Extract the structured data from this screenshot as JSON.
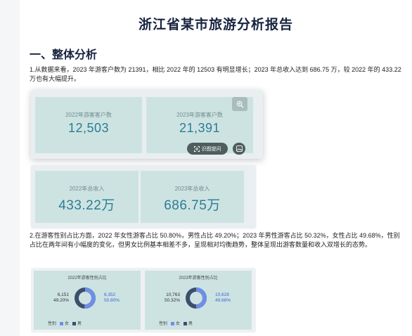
{
  "report": {
    "title": "浙江省某市旅游分析报告",
    "section1_heading": "一、整体分析",
    "paragraph1": "1.从数据来看，2023 年游客户数为 21391，相比 2022 年的 12503 有明显增长；2023 年总收入达到 686.75 万，较 2022 年的 433.22 万也有大幅提升。",
    "paragraph2": "2.在游客性别占比方面，2022 年女性游客占比 50.80%，男性占比 49.20%；2023 年男性游客占比 50.32%，女性占比 49.68%，性别占比在两年间有小幅度的变化，但男女比例基本相差不多，呈现相对均衡趋势，整体呈现出游客数量和收入双增长的态势。"
  },
  "kpis_customers": {
    "k2022_label": "2022年游客客户数",
    "k2022_value": "12,503",
    "k2023_label": "2023年游客客户数",
    "k2023_value": "21,391"
  },
  "kpis_income": {
    "k2022_label": "2022年总收入",
    "k2022_value": "433.22万",
    "k2023_label": "2023年总收入",
    "k2023_value": "686.75万"
  },
  "toolbar": {
    "ask_label": "识图提问",
    "zoom_icon": "zoom-in-icon",
    "image_icon": "image-icon"
  },
  "gender": {
    "legend_title": "性别",
    "female_label": "女",
    "male_label": "男",
    "female_color": "#6e8fe6",
    "male_color": "#3d4f6b",
    "y2022": {
      "title": "2022年游客性别占比",
      "male_count": "6,151",
      "male_pct": "49.20%",
      "female_count": "6,352",
      "female_pct": "50.80%",
      "female_share": 0.508
    },
    "y2023": {
      "title": "2023年游客性别占比",
      "male_count": "10,763",
      "male_pct": "50.32%",
      "female_count": "10,628",
      "female_pct": "49.68%",
      "female_share": 0.4968
    }
  }
}
